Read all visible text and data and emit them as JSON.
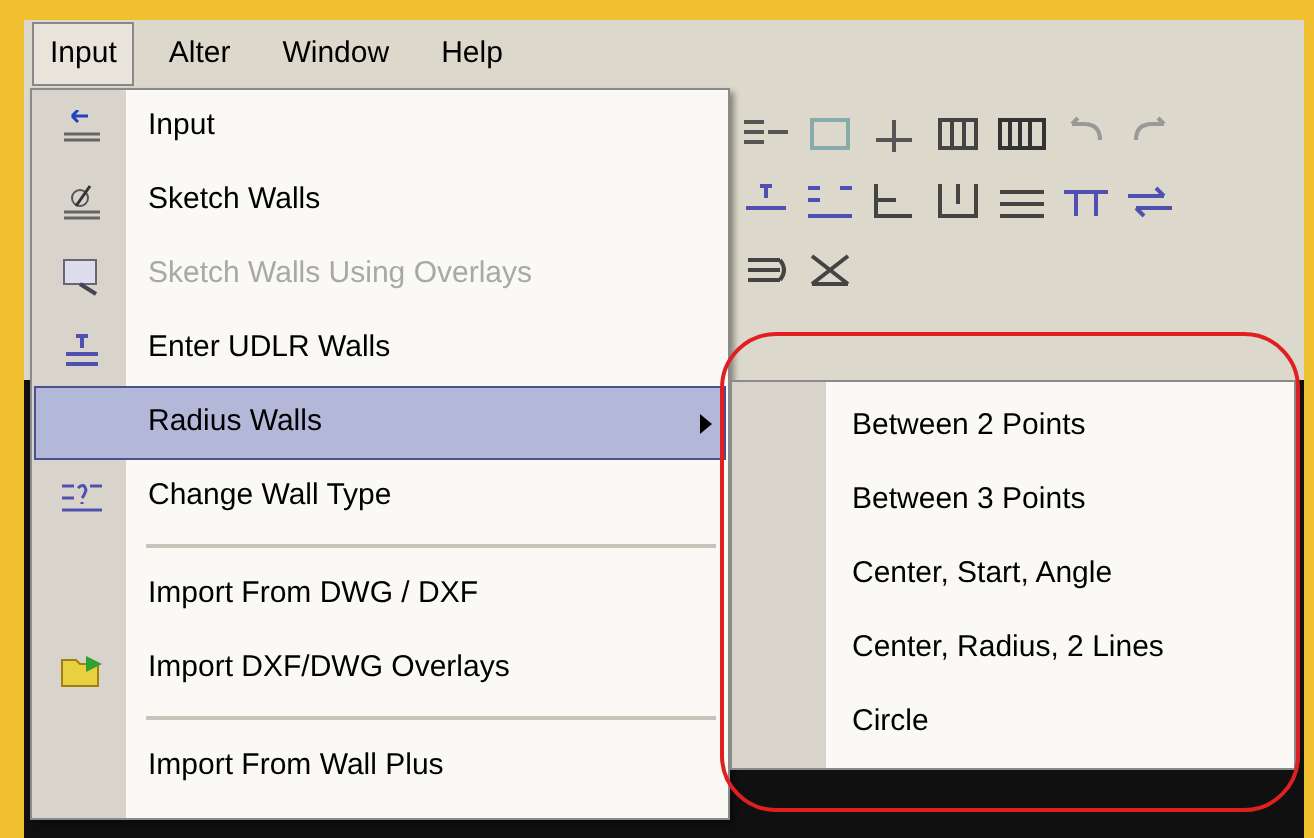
{
  "menu_bar": [
    {
      "label": "Input",
      "selected": true
    },
    {
      "label": "Alter",
      "selected": false
    },
    {
      "label": "Window",
      "selected": false
    },
    {
      "label": "Help",
      "selected": false
    }
  ],
  "menu": {
    "items": [
      {
        "kind": "item",
        "label": "Input",
        "disabled": false,
        "selected": false,
        "submenu": false
      },
      {
        "kind": "item",
        "label": "Sketch Walls",
        "disabled": false,
        "selected": false,
        "submenu": false
      },
      {
        "kind": "item",
        "label": "Sketch Walls Using Overlays",
        "disabled": true,
        "selected": false,
        "submenu": false
      },
      {
        "kind": "item",
        "label": "Enter UDLR Walls",
        "disabled": false,
        "selected": false,
        "submenu": false
      },
      {
        "kind": "item",
        "label": "Radius Walls",
        "disabled": false,
        "selected": true,
        "submenu": true
      },
      {
        "kind": "item",
        "label": "Change Wall Type",
        "disabled": false,
        "selected": false,
        "submenu": false
      },
      {
        "kind": "separator"
      },
      {
        "kind": "item",
        "label": "Import From DWG / DXF",
        "disabled": false,
        "selected": false,
        "submenu": false
      },
      {
        "kind": "item",
        "label": "Import DXF/DWG Overlays",
        "disabled": false,
        "selected": false,
        "submenu": false
      },
      {
        "kind": "separator"
      },
      {
        "kind": "item",
        "label": "Import From Wall Plus",
        "disabled": false,
        "selected": false,
        "submenu": false
      }
    ]
  },
  "submenu": {
    "items": [
      {
        "label": "Between 2 Points"
      },
      {
        "label": "Between 3 Points"
      },
      {
        "label": "Center, Start, Angle"
      },
      {
        "label": "Center, Radius, 2 Lines"
      },
      {
        "label": "Circle"
      }
    ]
  }
}
